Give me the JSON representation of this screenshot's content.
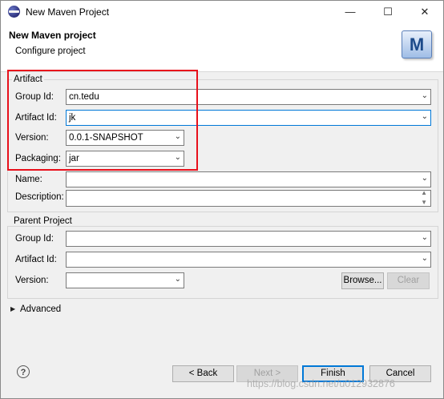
{
  "window": {
    "title": "New Maven Project",
    "controls": {
      "minimize": "—",
      "maximize": "☐",
      "close": "✕"
    }
  },
  "header": {
    "title": "New Maven project",
    "subtitle": "Configure project",
    "logo_letter": "M"
  },
  "artifact": {
    "group_title": "Artifact",
    "group_id": {
      "label": "Group Id:",
      "value": "cn.tedu"
    },
    "artifact_id": {
      "label": "Artifact Id:",
      "value": "jk"
    },
    "version": {
      "label": "Version:",
      "value": "0.0.1-SNAPSHOT"
    },
    "packaging": {
      "label": "Packaging:",
      "value": "jar"
    },
    "name": {
      "label": "Name:",
      "value": ""
    },
    "description": {
      "label": "Description:",
      "value": ""
    }
  },
  "parent": {
    "group_title": "Parent Project",
    "group_id": {
      "label": "Group Id:",
      "value": ""
    },
    "artifact_id": {
      "label": "Artifact Id:",
      "value": ""
    },
    "version": {
      "label": "Version:",
      "value": ""
    },
    "browse_label": "Browse...",
    "clear_label": "Clear"
  },
  "advanced": {
    "label": "Advanced"
  },
  "footer": {
    "help_glyph": "?",
    "back": "< Back",
    "next": "Next >",
    "finish": "Finish",
    "cancel": "Cancel"
  },
  "watermark": "https://blog.csdn.net/u012932876",
  "colors": {
    "highlight": "#e8101b",
    "focus": "#0078d7"
  }
}
